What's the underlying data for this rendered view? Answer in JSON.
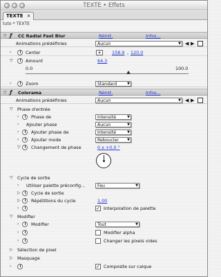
{
  "window": {
    "title": "TEXTE • Effets"
  },
  "tab": {
    "label": "TEXTE",
    "close": "×"
  },
  "breadcrumb": "tuto * TEXTE",
  "common": {
    "reset": "Réinit.",
    "infos": "Infos...",
    "presets_label": "Animations prédéfinies",
    "presets_value": "Aucun"
  },
  "fast_blur": {
    "name": "CC Radial Fast Blur",
    "center_label": "Center",
    "center_x": "158.9",
    "center_y": "120.0",
    "amount_label": "Amount",
    "amount_value": "64.3",
    "slider_min": "0.0",
    "slider_max": "100.0",
    "zoom_label": "Zoom",
    "zoom_value": "Standard"
  },
  "colorama": {
    "name": "Colorama",
    "input_phase": {
      "label": "Phase d'entrée",
      "phase_de_label": "Phase de",
      "phase_de_value": "Intensité",
      "add_phase_label": "Ajouter phase",
      "add_phase_value": "Aucun",
      "add_phase_de_label": "Ajouter phase de",
      "add_phase_de_value": "Intensité",
      "add_mode_label": "Ajouter mode",
      "add_mode_value": "Reboucler",
      "shift_label": "Changement de phase",
      "shift_value": "0 x +0.0 °"
    },
    "output_cycle": {
      "label": "Cycle de sortie",
      "palette_label": "Utiliser palette préconfig...",
      "palette_value": "Feu",
      "cycle_label": "Cycle de sortie",
      "reps_label": "Répétitions du cycle",
      "reps_value": "1.00",
      "interp_label": "Interpolation de palette"
    },
    "modify": {
      "label": "Modifier",
      "modify_label": "Modifier",
      "modify_value": "Tout",
      "alpha_label": "Modifier alpha",
      "empty_label": "Changer les pixels vides"
    },
    "pixel_selection": "Sélection de pixel",
    "masking": "Masquage",
    "composite_label": "Composite sur calque"
  }
}
